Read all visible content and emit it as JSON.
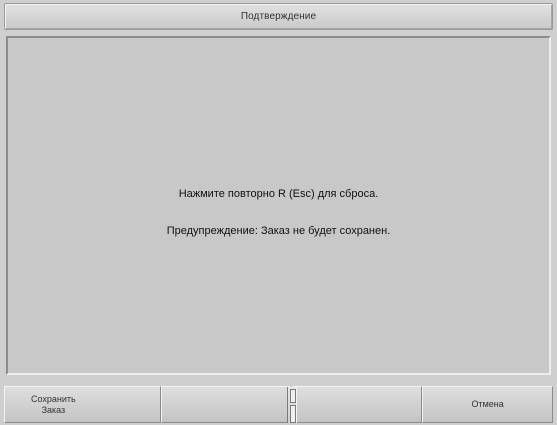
{
  "window": {
    "title": "Подтверждение"
  },
  "message": {
    "line1": "Нажмите повторно R (Esc) для сброса.",
    "line2": "Предупреждение: Заказ не будет сохранен."
  },
  "function_keys": [
    {
      "label": "Сохранить\nЗаказ"
    },
    {
      "label": ""
    },
    {
      "label": ""
    },
    {
      "label": "Отмена"
    }
  ]
}
